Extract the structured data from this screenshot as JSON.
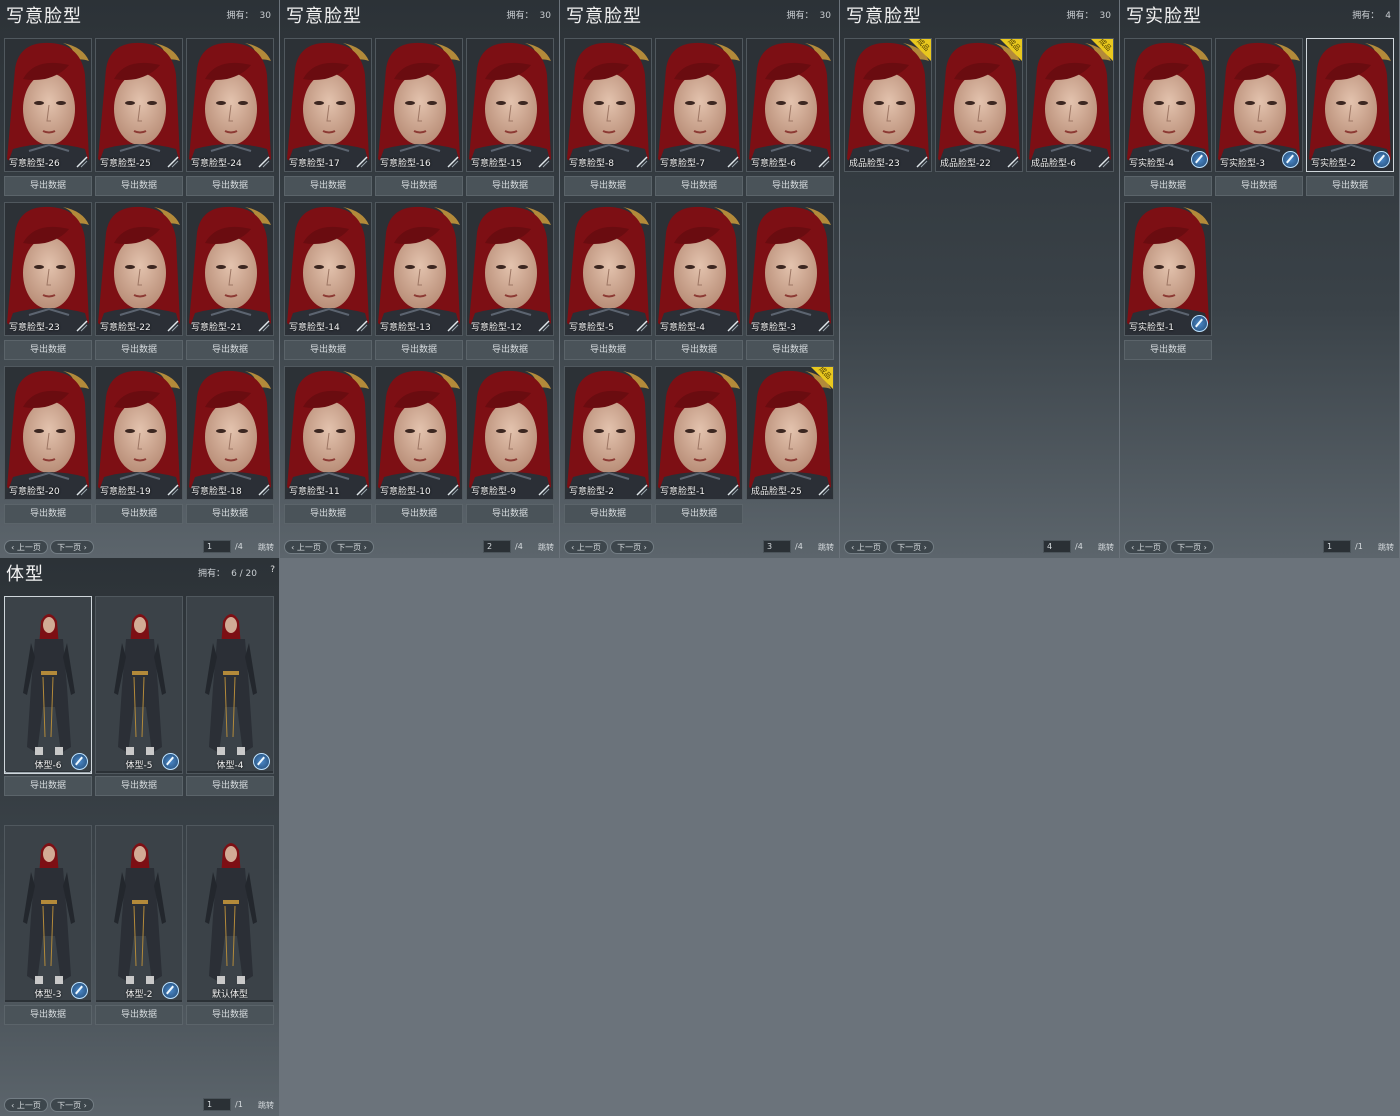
{
  "face_panels": [
    {
      "title": "写意脸型",
      "owned_label": "拥有：",
      "owned_count": "30",
      "cards": [
        {
          "label": "写意脸型-26",
          "export": "导出数据",
          "badge": false
        },
        {
          "label": "写意脸型-25",
          "export": "导出数据",
          "badge": false
        },
        {
          "label": "写意脸型-24",
          "export": "导出数据",
          "badge": false
        },
        {
          "label": "写意脸型-23",
          "export": "导出数据",
          "badge": false
        },
        {
          "label": "写意脸型-22",
          "export": "导出数据",
          "badge": false
        },
        {
          "label": "写意脸型-21",
          "export": "导出数据",
          "badge": false
        },
        {
          "label": "写意脸型-20",
          "export": "导出数据",
          "badge": false
        },
        {
          "label": "写意脸型-19",
          "export": "导出数据",
          "badge": false
        },
        {
          "label": "写意脸型-18",
          "export": "导出数据",
          "badge": false
        }
      ],
      "prev": "上一页",
      "next": "下一页",
      "page": "1",
      "total": "/4",
      "jump": "跳转"
    },
    {
      "title": "写意脸型",
      "owned_label": "拥有：",
      "owned_count": "30",
      "cards": [
        {
          "label": "写意脸型-17",
          "export": "导出数据",
          "badge": false
        },
        {
          "label": "写意脸型-16",
          "export": "导出数据",
          "badge": false
        },
        {
          "label": "写意脸型-15",
          "export": "导出数据",
          "badge": false
        },
        {
          "label": "写意脸型-14",
          "export": "导出数据",
          "badge": false
        },
        {
          "label": "写意脸型-13",
          "export": "导出数据",
          "badge": false
        },
        {
          "label": "写意脸型-12",
          "export": "导出数据",
          "badge": false
        },
        {
          "label": "写意脸型-11",
          "export": "导出数据",
          "badge": false
        },
        {
          "label": "写意脸型-10",
          "export": "导出数据",
          "badge": false
        },
        {
          "label": "写意脸型-9",
          "export": "导出数据",
          "badge": false
        }
      ],
      "prev": "上一页",
      "next": "下一页",
      "page": "2",
      "total": "/4",
      "jump": "跳转"
    },
    {
      "title": "写意脸型",
      "owned_label": "拥有：",
      "owned_count": "30",
      "cards": [
        {
          "label": "写意脸型-8",
          "export": "导出数据",
          "badge": false
        },
        {
          "label": "写意脸型-7",
          "export": "导出数据",
          "badge": false
        },
        {
          "label": "写意脸型-6",
          "export": "导出数据",
          "badge": false
        },
        {
          "label": "写意脸型-5",
          "export": "导出数据",
          "badge": false
        },
        {
          "label": "写意脸型-4",
          "export": "导出数据",
          "badge": false
        },
        {
          "label": "写意脸型-3",
          "export": "导出数据",
          "badge": false
        },
        {
          "label": "写意脸型-2",
          "export": "导出数据",
          "badge": false
        },
        {
          "label": "写意脸型-1",
          "export": "导出数据",
          "badge": false
        },
        {
          "label": "成品脸型-25",
          "export": "",
          "badge": true
        }
      ],
      "prev": "上一页",
      "next": "下一页",
      "page": "3",
      "total": "/4",
      "jump": "跳转"
    },
    {
      "title": "写意脸型",
      "owned_label": "拥有：",
      "owned_count": "30",
      "cards": [
        {
          "label": "成品脸型-23",
          "export": "",
          "badge": true
        },
        {
          "label": "成品脸型-22",
          "export": "",
          "badge": true
        },
        {
          "label": "成品脸型-6",
          "export": "",
          "badge": true
        }
      ],
      "prev": "上一页",
      "next": "下一页",
      "page": "4",
      "total": "/4",
      "jump": "跳转"
    },
    {
      "title": "写实脸型",
      "owned_label": "拥有：",
      "owned_count": "4",
      "cards": [
        {
          "label": "写实脸型-4",
          "export": "导出数据",
          "badge": false,
          "brush": true
        },
        {
          "label": "写实脸型-3",
          "export": "导出数据",
          "badge": false,
          "brush": true
        },
        {
          "label": "写实脸型-2",
          "export": "导出数据",
          "badge": false,
          "brush": true,
          "selected": true
        },
        {
          "label": "写实脸型-1",
          "export": "导出数据",
          "badge": false,
          "brush": true
        }
      ],
      "prev": "上一页",
      "next": "下一页",
      "page": "1",
      "total": "/1",
      "jump": "跳转"
    }
  ],
  "body_panel": {
    "title": "体型",
    "owned_label": "拥有：",
    "owned_count": "6 / 20",
    "help": "?",
    "cards": [
      {
        "label": "体型-6",
        "export": "导出数据",
        "brush": true,
        "selected": true
      },
      {
        "label": "体型-5",
        "export": "导出数据",
        "brush": true
      },
      {
        "label": "体型-4",
        "export": "导出数据",
        "brush": true
      },
      {
        "label": "体型-3",
        "export": "导出数据",
        "brush": true
      },
      {
        "label": "体型-2",
        "export": "导出数据",
        "brush": true
      },
      {
        "label": "默认体型",
        "export": "导出数据",
        "brush": false
      }
    ],
    "prev": "上一页",
    "next": "下一页",
    "page": "1",
    "total": "/1",
    "jump": "跳转"
  },
  "badge_text": "成品",
  "colors": {
    "hair": "#7d0f14",
    "skin": "#d2ab95",
    "armor": "#2b2f36",
    "gold": "#b38a3a",
    "badge": "#e9c81e",
    "brush_icon": "#4b89c9"
  },
  "icons": {
    "brush": "brush-edit-icon",
    "slash": "blade-slash-icon",
    "prev": "chevron-left-icon",
    "next": "chevron-right-icon"
  }
}
